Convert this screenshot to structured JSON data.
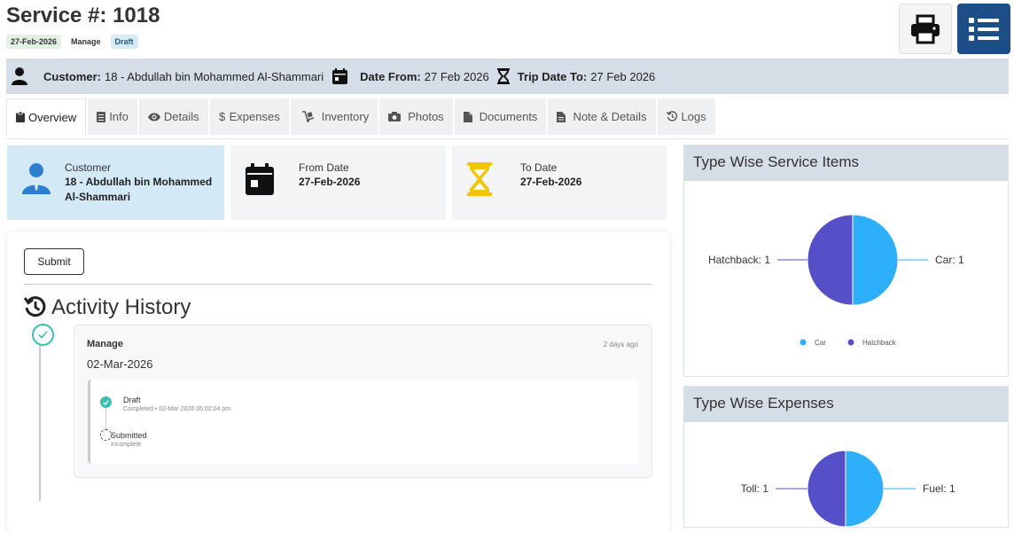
{
  "header": {
    "title": "Service #: 1018",
    "date_badge": "27-Feb-2026",
    "manage_badge": "Manage",
    "status_badge": "Draft"
  },
  "infobar": {
    "customer_label": "Customer:",
    "customer_value": "18 - Abdullah bin Mohammed Al-Shammari",
    "date_from_label": "Date From:",
    "date_from_value": "27 Feb 2026",
    "trip_date_label": "Trip Date To:",
    "trip_date_value": "27 Feb 2026"
  },
  "tabs": [
    {
      "label": "Overview",
      "icon": "clipboard-icon"
    },
    {
      "label": "Info",
      "icon": "document-icon"
    },
    {
      "label": "Details",
      "icon": "eye-icon"
    },
    {
      "label": "Expenses",
      "icon": "dollar-icon"
    },
    {
      "label": "Inventory",
      "icon": "dolly-icon"
    },
    {
      "label": "Photos",
      "icon": "camera-icon"
    },
    {
      "label": "Documents",
      "icon": "file-icon"
    },
    {
      "label": "Note & Details",
      "icon": "file-text-icon"
    },
    {
      "label": "Logs",
      "icon": "history-icon"
    }
  ],
  "cards": {
    "customer": {
      "label": "Customer",
      "value_line1": "18 - Abdullah bin Mohammed",
      "value_line2": "Al-Shammari"
    },
    "from_date": {
      "label": "From Date",
      "value": "27-Feb-2026"
    },
    "to_date": {
      "label": "To Date",
      "value": "27-Feb-2026"
    }
  },
  "actions": {
    "submit_label": "Submit"
  },
  "activity": {
    "title": "Activity History",
    "entry": {
      "name": "Manage",
      "ago": "2 days ago",
      "date": "02-Mar-2026",
      "steps": [
        {
          "name": "Draft",
          "meta": "Completed • 02-Mar-2026 05:02:04 pm"
        },
        {
          "name": "Submitted",
          "meta": "Incomplete"
        }
      ]
    }
  },
  "colors": {
    "car": "#2eaffb",
    "hatchback": "#5550c7",
    "fuel": "#2eaffb",
    "toll": "#5550c7"
  },
  "chart_data": [
    {
      "type": "pie",
      "title": "Type Wise Service Items",
      "categories": [
        "Car",
        "Hatchback"
      ],
      "values": [
        1,
        1
      ],
      "data_labels": [
        "Car: 1",
        "Hatchback: 1"
      ],
      "legend": "bottom"
    },
    {
      "type": "pie",
      "title": "Type Wise Expenses",
      "categories": [
        "Fuel",
        "Toll"
      ],
      "values": [
        1,
        1
      ],
      "data_labels": [
        "Fuel: 1",
        "Toll: 1"
      ]
    }
  ]
}
